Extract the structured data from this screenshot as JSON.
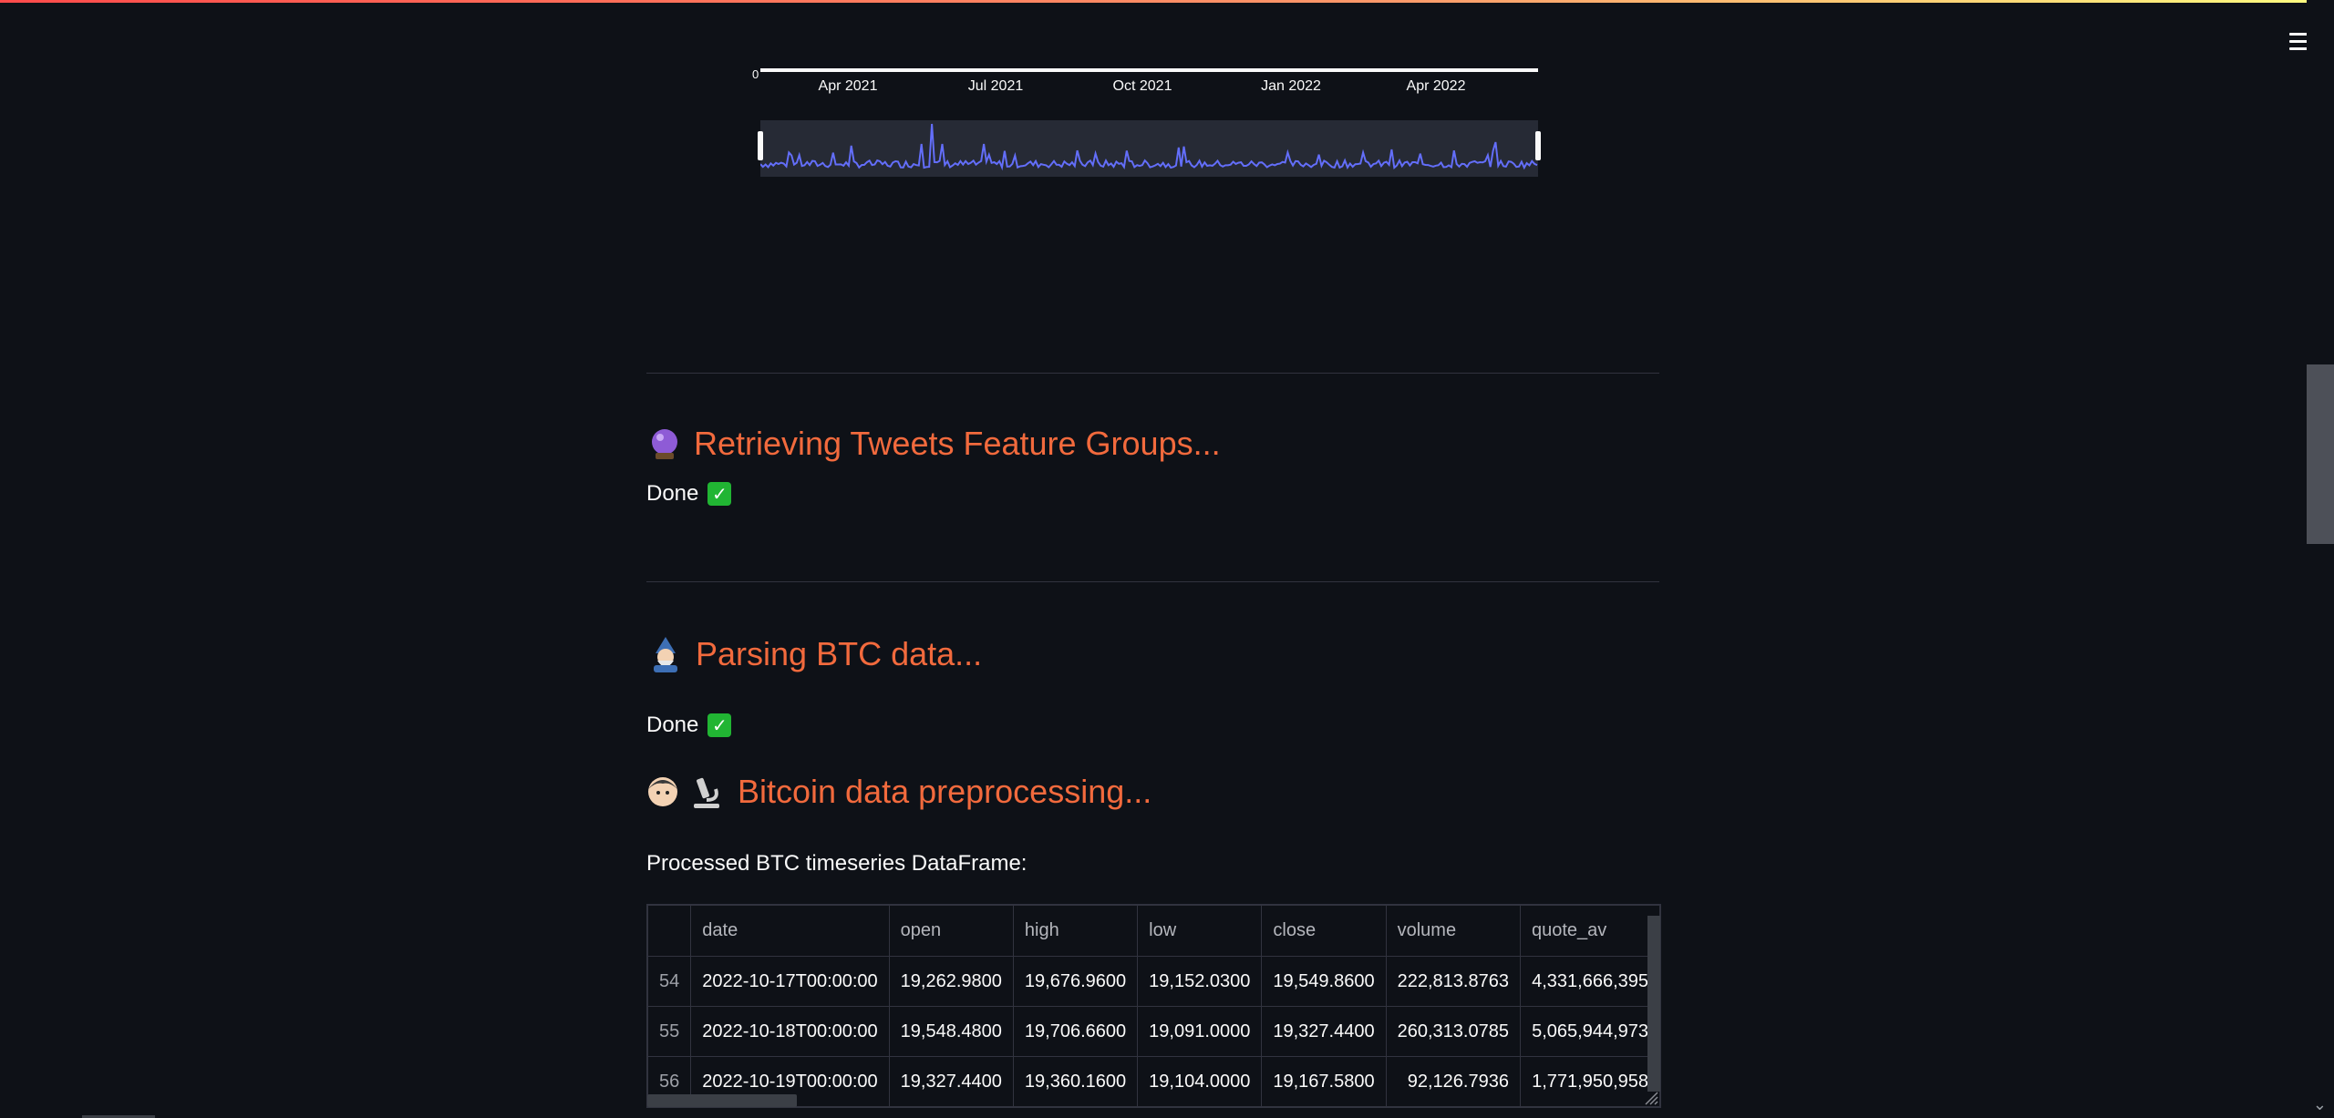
{
  "header": {
    "menu_icon": "hamburger-menu-icon"
  },
  "chart": {
    "chart_data": {
      "type": "line",
      "xlabel": "",
      "ylabel": "",
      "y_tick_label": "0",
      "x_ticks": [
        "Apr 2021",
        "Jul 2021",
        "Oct 2021",
        "Jan 2022",
        "Apr 2022"
      ],
      "range_slider": true,
      "series_color": "#636efa"
    }
  },
  "sections": [
    {
      "emoji": "crystal-ball-icon",
      "title": "Retrieving Tweets Feature Groups...",
      "status": "Done",
      "status_icon": "check-mark-icon"
    },
    {
      "emoji": "mage-icon",
      "title": "Parsing BTC data...",
      "status": "Done",
      "status_icon": "check-mark-icon"
    },
    {
      "emoji": "scientist-icon",
      "title": "Bitcoin data preprocessing..."
    }
  ],
  "table": {
    "caption": "Processed BTC timeseries DataFrame:",
    "columns": [
      "",
      "date",
      "open",
      "high",
      "low",
      "close",
      "volume",
      "quote_av"
    ],
    "rows": [
      [
        "54",
        "2022-10-17T00:00:00",
        "19,262.9800",
        "19,676.9600",
        "19,152.0300",
        "19,549.8600",
        "222,813.8763",
        "4,331,666,395"
      ],
      [
        "55",
        "2022-10-18T00:00:00",
        "19,548.4800",
        "19,706.6600",
        "19,091.0000",
        "19,327.4400",
        "260,313.0785",
        "5,065,944,973"
      ],
      [
        "56",
        "2022-10-19T00:00:00",
        "19,327.4400",
        "19,360.1600",
        "19,104.0000",
        "19,167.5800",
        "92,126.7936",
        "1,771,950,958"
      ]
    ]
  },
  "colors": {
    "accent": "#f26a3d",
    "background": "#0e1117",
    "line": "#636efa"
  }
}
